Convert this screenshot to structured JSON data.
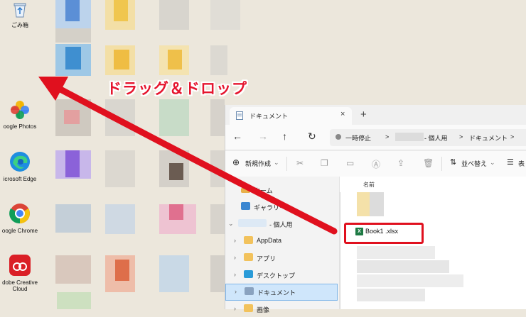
{
  "annotation": {
    "label": "ドラッグ＆ドロップ",
    "arrow_color": "#e0101e"
  },
  "desktop": {
    "icons": [
      {
        "name": "recycle-bin",
        "label": "ごみ箱",
        "icon": "recycle-icon"
      },
      {
        "name": "google-photos",
        "label": "oogle Photos",
        "icon": "pinwheel-icon"
      },
      {
        "name": "microsoft-edge",
        "label": "icrosoft Edge",
        "icon": "edge-icon"
      },
      {
        "name": "google-chrome",
        "label": "oogle Chrome",
        "icon": "chrome-icon"
      },
      {
        "name": "adobe-creative-cloud",
        "label_line1": "dobe Creative",
        "label_line2": "Cloud",
        "icon": "creative-cloud-icon"
      }
    ]
  },
  "explorer": {
    "tab_title": "ドキュメント",
    "tab_close": "×",
    "new_tab": "+",
    "nav": {
      "back": "←",
      "forward": "→",
      "up": "↑",
      "refresh": "↻"
    },
    "breadcrumb": {
      "paused": "一時停止",
      "sep": ">",
      "user_suffix": "- 個人用",
      "folder": "ドキュメント"
    },
    "command_bar": {
      "new": "新規作成",
      "sort": "並べ替え",
      "view": "表"
    },
    "sidebar": [
      {
        "label": "ホーム",
        "icon": "home-icon"
      },
      {
        "label": "ギャラリー",
        "icon": "gallery-icon"
      },
      {
        "label": "- 個人用",
        "icon": "cloud-icon",
        "expanded": true
      },
      {
        "label": "AppData",
        "icon": "folder-icon"
      },
      {
        "label": "アプリ",
        "icon": "folder-icon"
      },
      {
        "label": "デスクトップ",
        "icon": "desktop-folder-icon"
      },
      {
        "label": "ドキュメント",
        "icon": "documents-folder-icon",
        "selected": true
      },
      {
        "label": "画像",
        "icon": "pictures-folder-icon"
      }
    ],
    "content": {
      "column_name": "名前",
      "file_name": "Book1 .xlsx",
      "file_icon_letter": "X"
    }
  }
}
